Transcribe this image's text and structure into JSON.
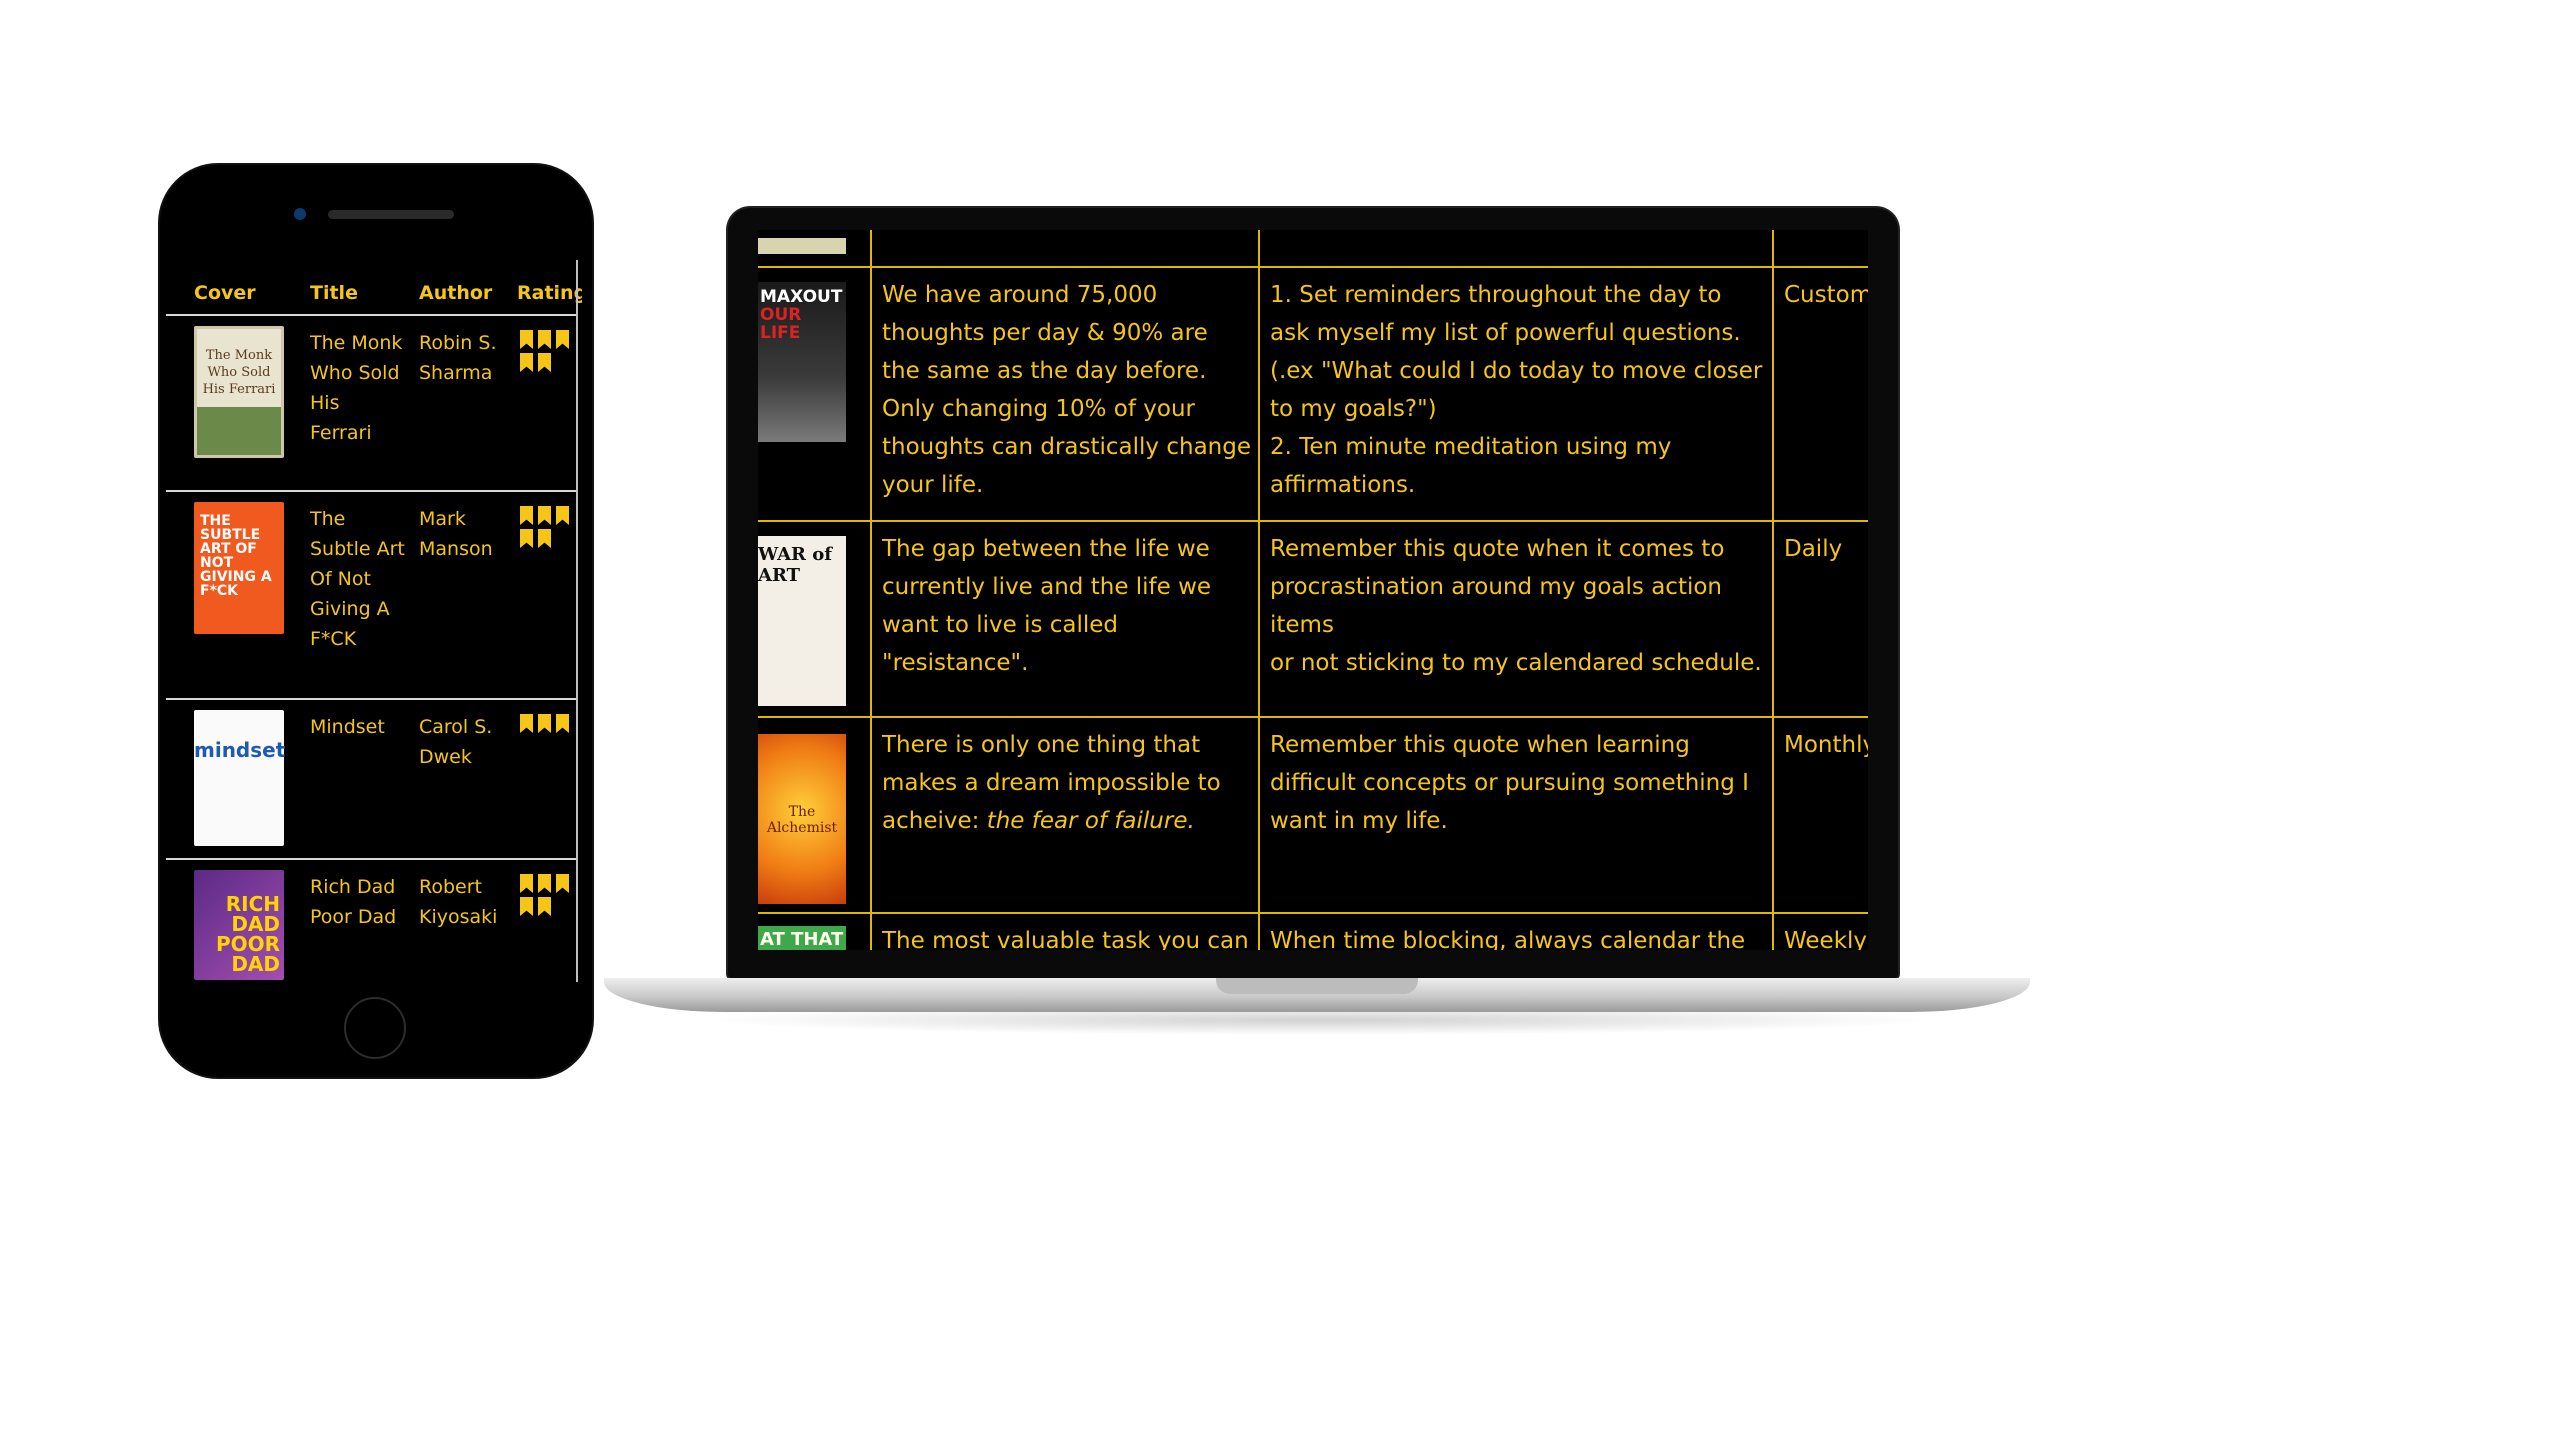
{
  "phone": {
    "headers": {
      "cover": "Cover",
      "title": "Title",
      "author": "Author",
      "rating": "Rating"
    },
    "rows": [
      {
        "title": "The Monk Who Sold His Ferrari",
        "author": "Robin S. Sharma",
        "cover_text": "The Monk Who Sold His Ferrari",
        "rating": 5
      },
      {
        "title": "The Subtle Art Of Not Giving A F*CK",
        "author": "Mark Manson",
        "cover_text": "THE SUBTLE ART OF NOT GIVING A F*CK",
        "rating": 5
      },
      {
        "title": "Mindset",
        "author": "Carol S. Dwek",
        "cover_text": "mindset",
        "rating": 3
      },
      {
        "title": "Rich Dad Poor Dad",
        "author": "Robert Kiyosaki",
        "cover_text": "RICH DAD POOR DAD",
        "rating": 5
      }
    ]
  },
  "laptop": {
    "rows": [
      {
        "cover_text": "MAXOUT",
        "cover_text2": "OUR LIFE",
        "quote": "We have around 75,000 thoughts per day & 90% are the same as the day before. Only changing 10% of your thoughts can drastically change your life.",
        "action_lines": [
          "1. Set reminders throughout the day to ask myself my list of powerful questions.",
          "(.ex \"What could I do today to move closer to my goals?\")",
          "2. Ten minute meditation using my affirmations."
        ],
        "frequency": "Custom"
      },
      {
        "cover_text": "WAR of ART",
        "quote": "The gap between the life we currently live and the life we want to live is called \"resistance\".",
        "action_lines": [
          "Remember this quote when it comes to procrastination around my goals action items",
          "or not sticking to my calendared schedule."
        ],
        "frequency": "Daily"
      },
      {
        "cover_text": "The Alchemist",
        "quote_start": "There is only one thing that makes a dream impossible to acheive: ",
        "quote_em": "the fear of failure.",
        "action_lines": [
          "Remember this quote when learning difficult concepts or pursuing something I want in my life."
        ],
        "frequency": "Monthly"
      },
      {
        "cover_text": "AT THAT",
        "quote": "The most valuable task you can",
        "action_lines": [
          "When time blocking, always calendar the"
        ],
        "frequency": "Weekly"
      }
    ]
  },
  "colors": {
    "accent": "#f5c518",
    "background": "#000000"
  }
}
